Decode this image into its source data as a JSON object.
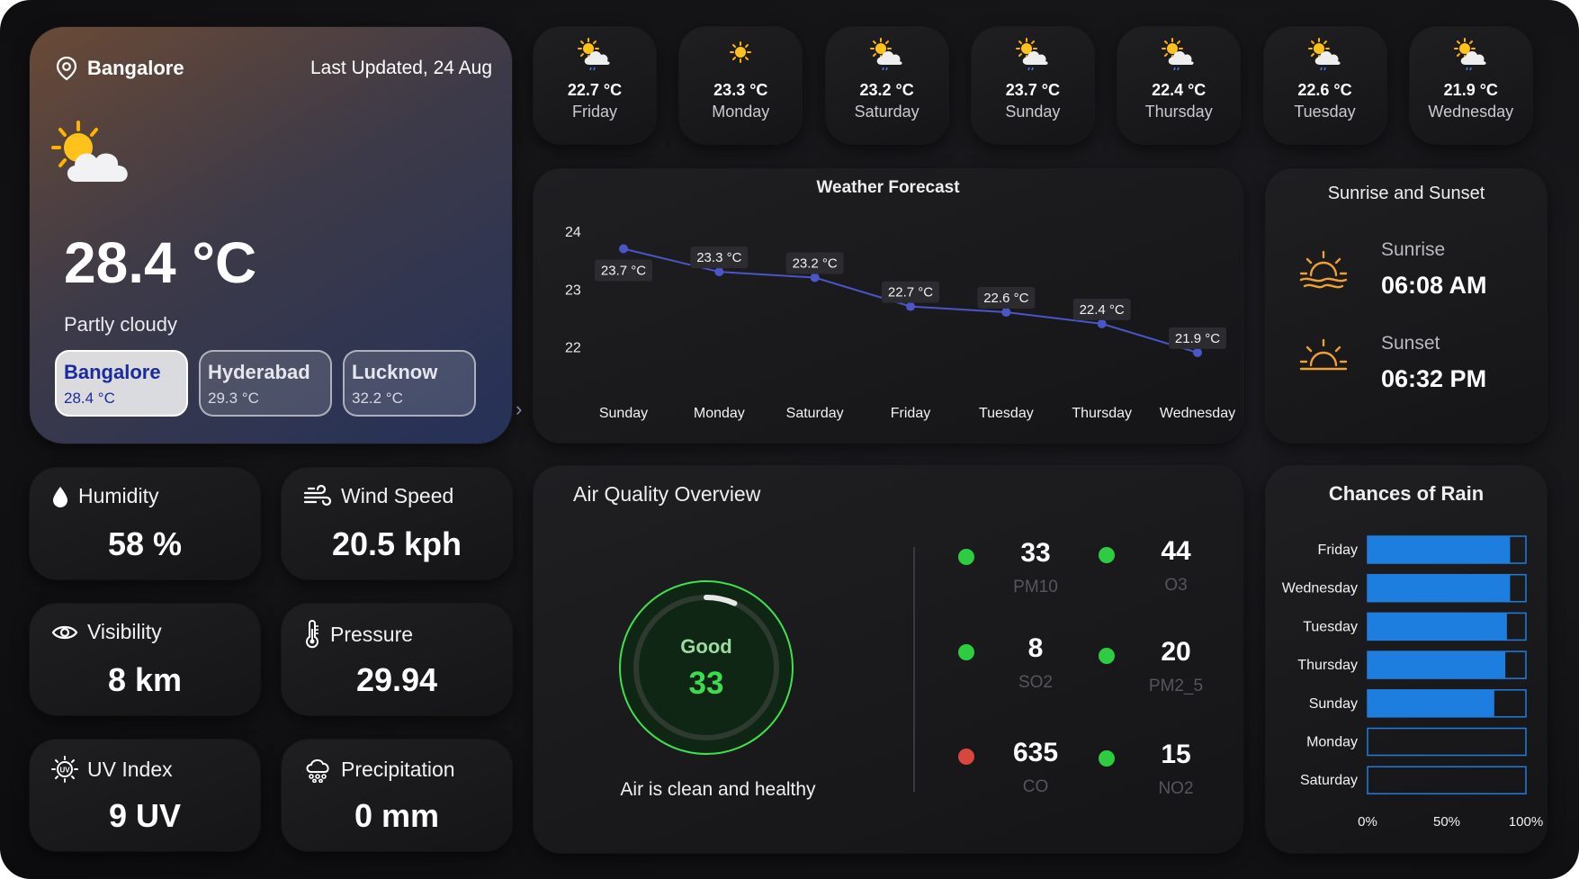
{
  "location": {
    "city": "Bangalore",
    "last_updated": "Last Updated, 24 Aug",
    "temperature": "28.4 °C",
    "condition": "Partly cloudy",
    "icon": "partly-cloudy-icon"
  },
  "cities": [
    {
      "name": "Bangalore",
      "temp": "28.4 °C",
      "active": true
    },
    {
      "name": "Hyderabad",
      "temp": "29.3 °C",
      "active": false
    },
    {
      "name": "Lucknow",
      "temp": "32.2 °C",
      "active": false
    }
  ],
  "days": [
    {
      "temp": "22.7 °C",
      "day": "Friday",
      "icon": "rain-partly-cloudy-icon"
    },
    {
      "temp": "23.3 °C",
      "day": "Monday",
      "icon": "sun-icon"
    },
    {
      "temp": "23.2 °C",
      "day": "Saturday",
      "icon": "rain-partly-cloudy-icon"
    },
    {
      "temp": "23.7 °C",
      "day": "Sunday",
      "icon": "rain-partly-cloudy-icon"
    },
    {
      "temp": "22.4 °C",
      "day": "Thursday",
      "icon": "rain-partly-cloudy-icon"
    },
    {
      "temp": "22.6 °C",
      "day": "Tuesday",
      "icon": "rain-partly-cloudy-icon"
    },
    {
      "temp": "21.9 °C",
      "day": "Wednesday",
      "icon": "rain-partly-cloudy-icon"
    }
  ],
  "metrics": {
    "humidity": {
      "label": "Humidity",
      "value": "58 %",
      "icon": "droplet-icon"
    },
    "wind": {
      "label": "Wind Speed",
      "value": "20.5 kph",
      "icon": "wind-icon"
    },
    "visibility": {
      "label": "Visibility",
      "value": "8 km",
      "icon": "eye-icon"
    },
    "pressure": {
      "label": "Pressure",
      "value": "29.94",
      "icon": "thermometer-icon"
    },
    "uv": {
      "label": "UV Index",
      "value": "9 UV",
      "icon": "uv-icon"
    },
    "precip": {
      "label": "Precipitation",
      "value": "0 mm",
      "icon": "rain-cloud-icon"
    }
  },
  "forecast": {
    "title": "Weather Forecast"
  },
  "sun": {
    "title": "Sunrise and Sunset",
    "sunrise_label": "Sunrise",
    "sunrise": "06:08 AM",
    "sunset_label": "Sunset",
    "sunset": "06:32 PM"
  },
  "air": {
    "title": "Air Quality Overview",
    "status": "Good",
    "index": "33",
    "index_value": 33,
    "message": "Air is clean and healthy",
    "pollutants": [
      {
        "value": "33",
        "name": "PM10",
        "color": "#2ecc40"
      },
      {
        "value": "44",
        "name": "O3",
        "color": "#2ecc40"
      },
      {
        "value": "8",
        "name": "SO2",
        "color": "#2ecc40"
      },
      {
        "value": "20",
        "name": "PM2_5",
        "color": "#2ecc40"
      },
      {
        "value": "635",
        "name": "CO",
        "color": "#d9463b"
      },
      {
        "value": "15",
        "name": "NO2",
        "color": "#2ecc40"
      }
    ]
  },
  "rain": {
    "title": "Chances of Rain"
  },
  "colors": {
    "accent": "#1e7ee0",
    "line": "#4a55c8",
    "good": "#2ecc40",
    "bad": "#d9463b"
  },
  "chart_data": [
    {
      "type": "line",
      "title": "Weather Forecast",
      "categories": [
        "Sunday",
        "Monday",
        "Saturday",
        "Friday",
        "Tuesday",
        "Thursday",
        "Wednesday"
      ],
      "values": [
        23.7,
        23.3,
        23.2,
        22.7,
        22.6,
        22.4,
        21.9
      ],
      "data_labels": [
        "23.7 °C",
        "23.3 °C",
        "23.2 °C",
        "22.7 °C",
        "22.6 °C",
        "22.4 °C",
        "21.9 °C"
      ],
      "yticks": [
        22,
        23,
        24
      ],
      "ylim": [
        21.4,
        24.3
      ]
    },
    {
      "type": "bar",
      "orientation": "horizontal",
      "title": "Chances of Rain",
      "categories": [
        "Friday",
        "Wednesday",
        "Tuesday",
        "Thursday",
        "Sunday",
        "Monday",
        "Saturday"
      ],
      "values": [
        90,
        90,
        88,
        87,
        80,
        0,
        0
      ],
      "xticks": [
        "0%",
        "50%",
        "100%"
      ],
      "xlim": [
        0,
        100
      ]
    }
  ]
}
